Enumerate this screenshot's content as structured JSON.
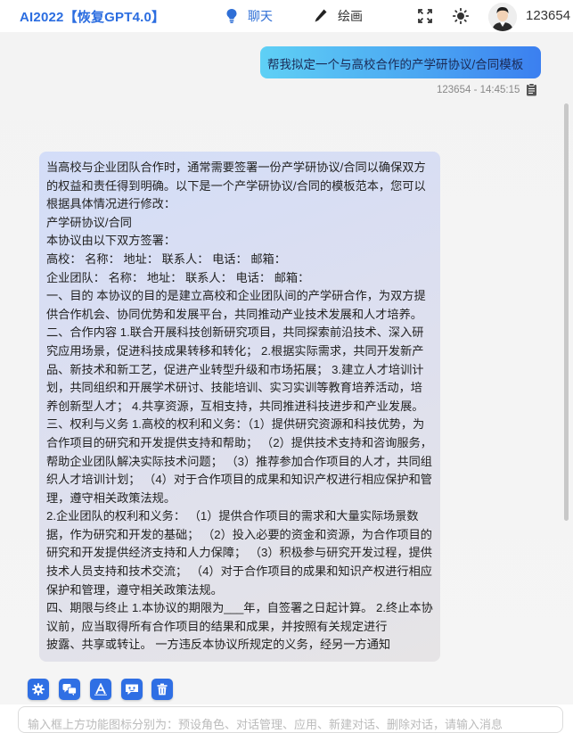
{
  "header": {
    "app_title": "AI2022【恢复GPT4.0】",
    "nav": [
      {
        "label": "聊天",
        "icon": "lightbulb-icon"
      },
      {
        "label": "绘画",
        "icon": "pencil-icon"
      }
    ],
    "fullscreen_icon": "fullscreen-icon",
    "theme_icon": "sun-icon",
    "username": "123654"
  },
  "chat": {
    "user_message": "帮我拟定一个与高校合作的产学研协议/合同模板",
    "user_meta": "123654 - 14:45:15",
    "copy_icon": "clipboard-icon",
    "ai_paragraphs": [
      "当高校与企业团队合作时，通常需要签署一份产学研协议/合同以确保双方的权益和责任得到明确。以下是一个产学研协议/合同的模板范本，您可以根据具体情况进行修改：",
      "产学研协议/合同",
      "本协议由以下双方签署：",
      "高校： 名称： 地址： 联系人： 电话： 邮箱：",
      "企业团队： 名称： 地址： 联系人： 电话： 邮箱：",
      "一、目的 本协议的目的是建立高校和企业团队间的产学研合作，为双方提供合作机会、协同优势和发展平台，共同推动产业技术发展和人才培养。",
      "二、合作内容 1.联合开展科技创新研究项目，共同探索前沿技术、深入研究应用场景，促进科技成果转移和转化； 2.根据实际需求，共同开发新产品、新技术和新工艺，促进产业转型升级和市场拓展； 3.建立人才培训计划，共同组织和开展学术研讨、技能培训、实习实训等教育培养活动，培养创新型人才； 4.共享资源，互相支持，共同推进科技进步和产业发展。",
      "三、权利与义务 1.高校的权利和义务：（1）提供研究资源和科技优势，为合作项目的研究和开发提供支持和帮助； （2）提供技术支持和咨询服务，帮助企业团队解决实际技术问题； （3）推荐参加合作项目的人才，共同组织人才培训计划； （4）对于合作项目的成果和知识产权进行相应保护和管理，遵守相关政策法规。",
      "2.企业团队的权利和义务： （1）提供合作项目的需求和大量实际场景数据，作为研究和开发的基础； （2）投入必要的资金和资源，为合作项目的研究和开发提供经济支持和人力保障； （3）积极参与研究开发过程，提供技术人员支持和技术交流； （4）对于合作项目的成果和知识产权进行相应保护和管理，遵守相关政策法规。",
      "四、期限与终止 1.本协议的期限为___年，自签署之日起计算。 2.终止本协议前，应当取得所有合作项目的结果和成果，并按照有关规定进行",
      "披露、共享或转让。 一方违反本协议所规定的义务，经另一方通知"
    ]
  },
  "toolbar": {
    "tools": [
      "gear-icon",
      "chat-bubbles-icon",
      "text-a-icon",
      "mask-icon",
      "trash-icon"
    ],
    "input_placeholder": "输入框上方功能图标分别为：预设角色、对话管理、应用、新建对话、删除对话，请输入消息"
  },
  "colors": {
    "accent": "#2f6fe4",
    "title": "#2b6de0",
    "user_bubble_start": "#5fd0f5",
    "user_bubble_end": "#3b7ff0"
  }
}
